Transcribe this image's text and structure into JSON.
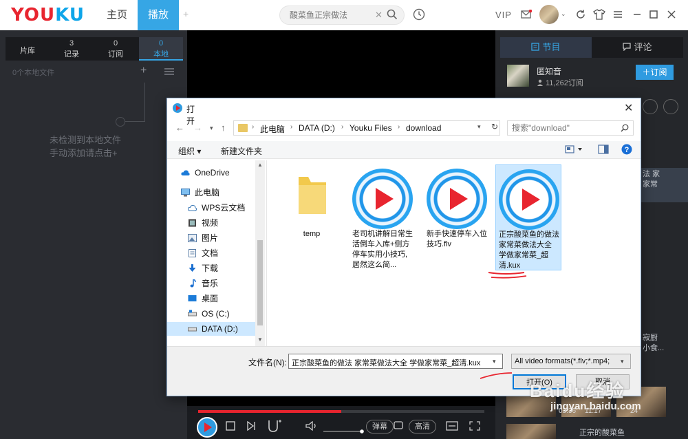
{
  "topbar": {
    "logo_a": "YOU",
    "logo_b": "KU",
    "nav_home": "主页",
    "nav_play": "播放",
    "nav_add": "+",
    "search_placeholder": "酸菜鱼正宗做法",
    "vip": "VIP"
  },
  "left": {
    "tabs": [
      {
        "label": "片库",
        "count": ""
      },
      {
        "label": "记录",
        "count": "3"
      },
      {
        "label": "订阅",
        "count": "0"
      },
      {
        "label": "本地",
        "count": "0"
      }
    ],
    "file_count": "0个本地文件",
    "add": "+",
    "hint_line1": "未检测到本地文件",
    "hint_line2": "手动添加请点击+"
  },
  "right": {
    "tab_programs": "节目",
    "tab_comments": "评论",
    "channel_name": "匿知音",
    "channel_subs": "11,262订阅",
    "subscribe": "＋订阅",
    "item1_line1": "法 家",
    "item1_line2": "家常",
    "item2_line1": "寂厨",
    "item2_line2": "小食...",
    "time1": "03:36",
    "time2": "11:17",
    "time3": "24",
    "bottom_title": "正宗的酸菜鱼"
  },
  "player": {
    "progress": 0.5,
    "danmu": "弹幕",
    "quality": "高清"
  },
  "dialog": {
    "title": "打开",
    "close": "✕",
    "path": [
      "此电脑",
      "DATA (D:)",
      "Youku Files",
      "download"
    ],
    "search_placeholder": "搜索\"download\"",
    "organize": "组织 ▾",
    "new_folder": "新建文件夹",
    "nav_items": [
      {
        "label": "OneDrive",
        "icon": "cloud-icon"
      },
      {
        "label": "此电脑",
        "icon": "computer-icon"
      },
      {
        "label": "WPS云文档",
        "icon": "cloud-icon"
      },
      {
        "label": "视频",
        "icon": "video-icon"
      },
      {
        "label": "图片",
        "icon": "picture-icon"
      },
      {
        "label": "文档",
        "icon": "document-icon"
      },
      {
        "label": "下载",
        "icon": "download-icon"
      },
      {
        "label": "音乐",
        "icon": "music-icon"
      },
      {
        "label": "桌面",
        "icon": "desktop-icon"
      },
      {
        "label": "OS (C:)",
        "icon": "drive-icon"
      },
      {
        "label": "DATA (D:)",
        "icon": "drive-icon"
      }
    ],
    "files": [
      {
        "name": "temp",
        "type": "folder"
      },
      {
        "name": "老司机讲解日常生活倒车入库+侧方停车实用小技巧, 居然这么简...",
        "type": "kux"
      },
      {
        "name": "新手快速停车入位技巧.flv",
        "type": "kux"
      },
      {
        "name": "正宗酸菜鱼的做法 家常菜做法大全 学做家常菜_超清.kux",
        "type": "kux"
      }
    ],
    "filename_label": "文件名(N):",
    "filename_value": "正宗酸菜鱼的做法 家常菜做法大全 学做家常菜_超清.kux",
    "filetype_value": "All video formats(*.flv;*.mp4;",
    "open_button": "打开(O)",
    "cancel_button": "取消"
  },
  "watermark": {
    "text": "Baidu经验",
    "url": "jingyan.baidu.com"
  },
  "colors": {
    "brand_red": "#e8252f",
    "brand_blue": "#36a6e5",
    "selection": "#cce8ff"
  }
}
